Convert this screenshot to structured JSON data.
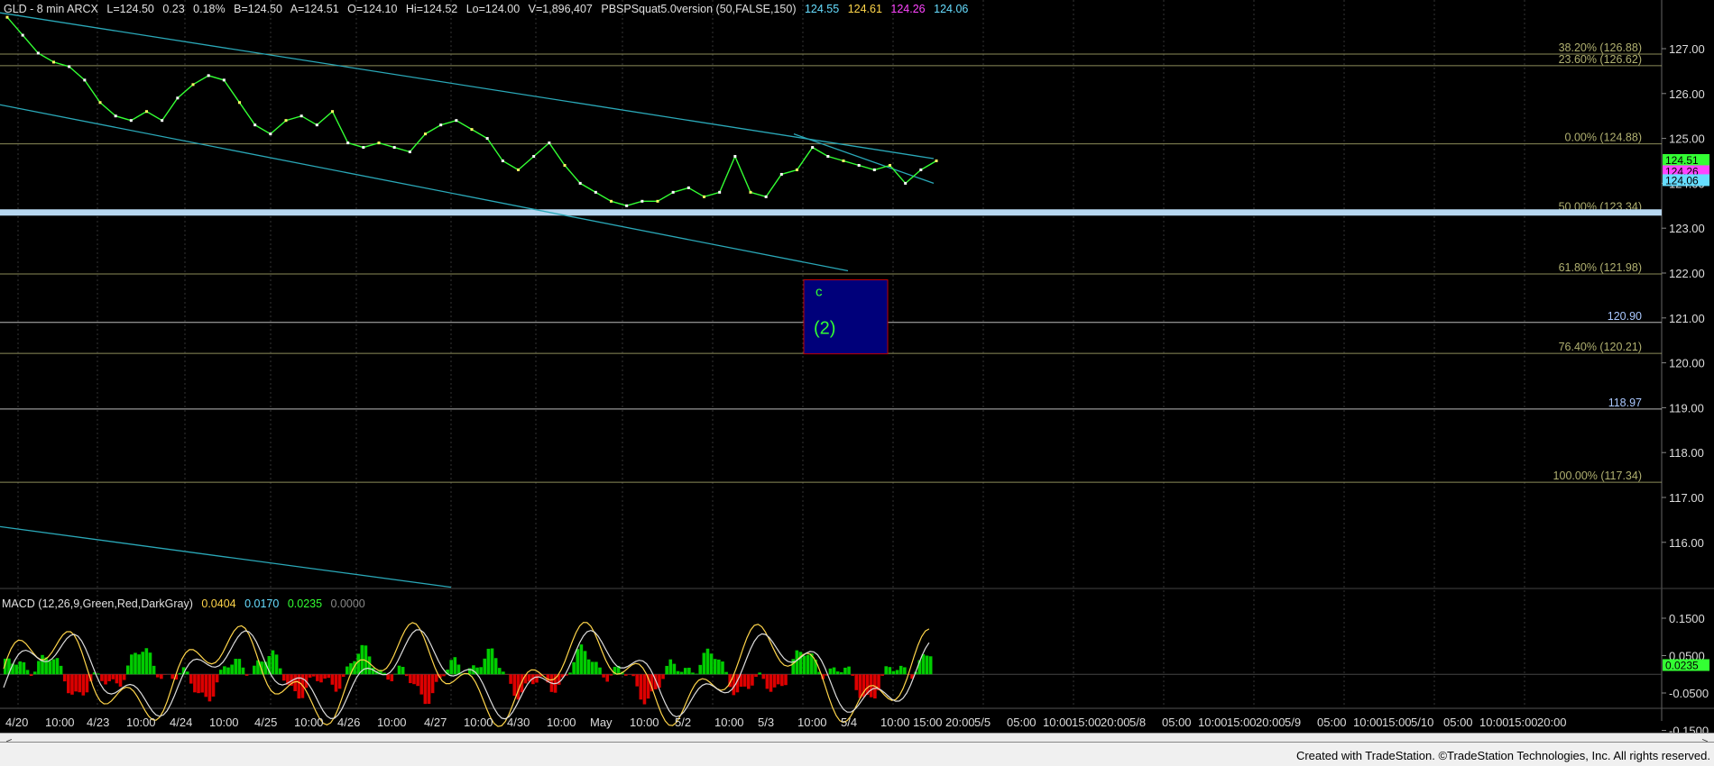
{
  "header": {
    "symbol": "GLD - 8 min  ARCX",
    "last": "L=124.50",
    "change": "0.23",
    "change_pct": "0.18%",
    "bid": "B=124.50",
    "ask": "A=124.51",
    "open": "O=124.10",
    "high": "Hi=124.52",
    "low": "Lo=124.00",
    "volume": "V=1,896,407",
    "study": "PBSPSquat5.0version (50,FALSE,150)",
    "v1": "124.55",
    "v2": "124.61",
    "v3": "124.26",
    "v4": "124.06"
  },
  "colors": {
    "bg": "#000000",
    "price": "#33ff33",
    "channel": "#2aa8b8",
    "support_band": "#b7d7f0",
    "fib": "#b0b070",
    "box_fill": "#00007a",
    "box_border": "#c00000",
    "macd_pos": "#00cc00",
    "macd_neg": "#dd0000",
    "v2": "#ffd54a",
    "v3": "#ff44ff",
    "v1": "#66ddff"
  },
  "fib_labels": [
    {
      "text": "38.20% (126.88)",
      "price": 126.88
    },
    {
      "text": "23.60% (126.62)",
      "price": 126.62
    },
    {
      "text": "0.00% (124.88)",
      "price": 124.88
    },
    {
      "text": "50.00% (123.34)",
      "price": 123.34
    },
    {
      "text": "61.80% (121.98)",
      "price": 121.98
    },
    {
      "text": "76.40% (120.21)",
      "price": 120.21
    },
    {
      "text": "100.00% (117.34)",
      "price": 117.34
    }
  ],
  "level_labels": [
    {
      "text": "120.90",
      "price": 120.9
    },
    {
      "text": "118.97",
      "price": 118.97
    }
  ],
  "price_axis_ticks": [
    "127.00",
    "126.00",
    "125.00",
    "124.00",
    "123.00",
    "122.00",
    "121.00",
    "120.00",
    "119.00",
    "118.00",
    "117.00",
    "116.00"
  ],
  "price_badges": [
    {
      "text": "124.51",
      "price": 124.51,
      "color": "#33ff33"
    },
    {
      "text": "124.26",
      "price": 124.26,
      "color": "#ff44ff"
    },
    {
      "text": "124.06",
      "price": 124.06,
      "color": "#66ddff"
    }
  ],
  "wave_box": {
    "label_c": "c",
    "label_2": "(2)",
    "top_price": 121.85,
    "bottom_price": 120.2
  },
  "macd": {
    "title": "MACD (12,26,9,Green,Red,DarkGray)",
    "v1": "0.0404",
    "v2": "0.0170",
    "v3": "0.0235",
    "v4": "0.0000",
    "ticks": [
      "0.1500",
      "0.0500",
      "-0.0500",
      "-0.1500"
    ],
    "badge": "0.0235"
  },
  "time_labels": [
    "4/20",
    "10:00",
    "4/23",
    "10:00",
    "4/24",
    "10:00",
    "4/25",
    "10:00",
    "4/26",
    "10:00",
    "4/27",
    "10:00",
    "4/30",
    "10:00",
    "May",
    "10:00",
    "5/2",
    "10:00",
    "5/3",
    "10:00",
    "5/4",
    "10:00",
    "15:00",
    "20:00",
    "5/5",
    "05:00",
    "10:00",
    "15:00",
    "20:00",
    "5/8",
    "05:00",
    "10:00",
    "15:00",
    "20:00",
    "5/9",
    "05:00",
    "10:00",
    "15:00",
    "5/10",
    "05:00",
    "10:00",
    "15:00",
    "20:00"
  ],
  "footer": "Created with TradeStation. ©TradeStation Technologies, Inc. All rights reserved.",
  "chart_data": {
    "type": "line",
    "title": "GLD - 8 min  ARCX",
    "ylim": [
      115.0,
      127.5
    ],
    "series": [
      {
        "name": "GLD",
        "values": [
          127.7,
          127.3,
          126.9,
          126.7,
          126.6,
          126.3,
          125.8,
          125.5,
          125.4,
          125.6,
          125.4,
          125.9,
          126.2,
          126.4,
          126.3,
          125.8,
          125.3,
          125.1,
          125.4,
          125.5,
          125.3,
          125.6,
          124.9,
          124.8,
          124.9,
          124.8,
          124.7,
          125.1,
          125.3,
          125.4,
          125.2,
          125.0,
          124.5,
          124.3,
          124.6,
          124.9,
          124.4,
          124.0,
          123.8,
          123.6,
          123.5,
          123.6,
          123.6,
          123.8,
          123.9,
          123.7,
          123.8,
          124.6,
          123.8,
          123.7,
          124.2,
          124.3,
          124.8,
          124.6,
          124.5,
          124.4,
          124.3,
          124.4,
          124.0,
          124.3,
          124.5
        ]
      }
    ]
  }
}
